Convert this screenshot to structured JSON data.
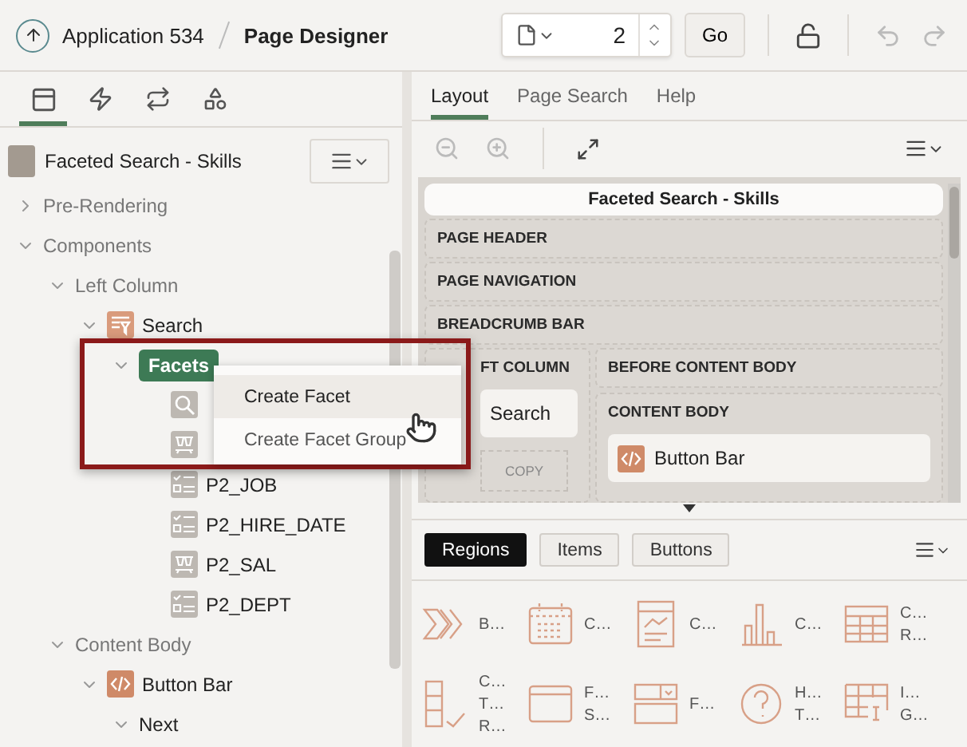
{
  "header": {
    "app_link": "Application 534",
    "title": "Page Designer",
    "page_number": "2",
    "go_button": "Go"
  },
  "left_tabs": [
    {
      "kind": "rendering",
      "selected": true
    },
    {
      "kind": "dynamic",
      "selected": false
    },
    {
      "kind": "processing",
      "selected": false
    },
    {
      "kind": "shared",
      "selected": false
    }
  ],
  "page_title": "Faceted Search - Skills",
  "tree": [
    {
      "label": "Pre-Rendering",
      "expanded": false,
      "selected": false
    },
    {
      "label": "Components",
      "expanded": true,
      "selected": false,
      "children": [
        {
          "label": "Left Column",
          "expanded": true,
          "selected": false,
          "children": [
            {
              "label": "Search",
              "kind": "search-region",
              "expanded": true,
              "selected": false,
              "children": [
                {
                  "label": "Facets",
                  "expanded": true,
                  "selected": true,
                  "children": [
                    {
                      "kind": "search",
                      "selected": false
                    },
                    {
                      "kind": "range",
                      "selected": false
                    },
                    {
                      "label": "P2_JOB",
                      "kind": "checkbox",
                      "selected": false
                    },
                    {
                      "label": "P2_HIRE_DATE",
                      "kind": "checkbox",
                      "selected": false
                    },
                    {
                      "label": "P2_SAL",
                      "kind": "range",
                      "selected": false
                    },
                    {
                      "label": "P2_DEPT",
                      "kind": "checkbox",
                      "selected": false
                    }
                  ]
                }
              ]
            }
          ]
        },
        {
          "label": "Content Body",
          "expanded": true,
          "selected": false,
          "children": [
            {
              "label": "Button Bar",
              "kind": "code",
              "expanded": true,
              "selected": false,
              "children": [
                {
                  "label": "Next",
                  "expanded": true,
                  "selected": false
                }
              ]
            }
          ]
        }
      ]
    }
  ],
  "context_menu": [
    {
      "label": "Create Facet",
      "selected": true
    },
    {
      "label": "Create Facet Group",
      "selected": false
    }
  ],
  "right_tabs": [
    {
      "label": "Layout",
      "selected": true
    },
    {
      "label": "Page Search",
      "selected": false
    },
    {
      "label": "Help",
      "selected": false
    }
  ],
  "layout": {
    "title": "Faceted Search - Skills",
    "rows": [
      "PAGE HEADER",
      "PAGE NAVIGATION",
      "BREADCRUMB BAR"
    ],
    "left_column": {
      "label": "FT COLUMN",
      "region": "Search",
      "copy": "COPY"
    },
    "before_content": "BEFORE CONTENT BODY",
    "content_body": {
      "label": "CONTENT BODY",
      "region": "Button Bar"
    }
  },
  "gallery_tabs": [
    {
      "label": "Regions",
      "selected": true
    },
    {
      "label": "Items",
      "selected": false
    },
    {
      "label": "Buttons",
      "selected": false
    }
  ],
  "gallery": [
    {
      "kind": "chevrons",
      "lines": [
        "B…"
      ]
    },
    {
      "kind": "calendar",
      "lines": [
        "C…"
      ]
    },
    {
      "kind": "card",
      "lines": [
        "C…"
      ]
    },
    {
      "kind": "chart",
      "lines": [
        "C…"
      ]
    },
    {
      "kind": "table",
      "lines": [
        "C…",
        "R…"
      ]
    },
    {
      "kind": "checklist",
      "lines": [
        "C…",
        "T…",
        "R…"
      ]
    },
    {
      "kind": "window",
      "lines": [
        "F…",
        "S…"
      ]
    },
    {
      "kind": "form",
      "lines": [
        "F…"
      ]
    },
    {
      "kind": "help",
      "lines": [
        "H…",
        "T…"
      ]
    },
    {
      "kind": "grid",
      "lines": [
        "I…",
        "G…"
      ]
    }
  ]
}
